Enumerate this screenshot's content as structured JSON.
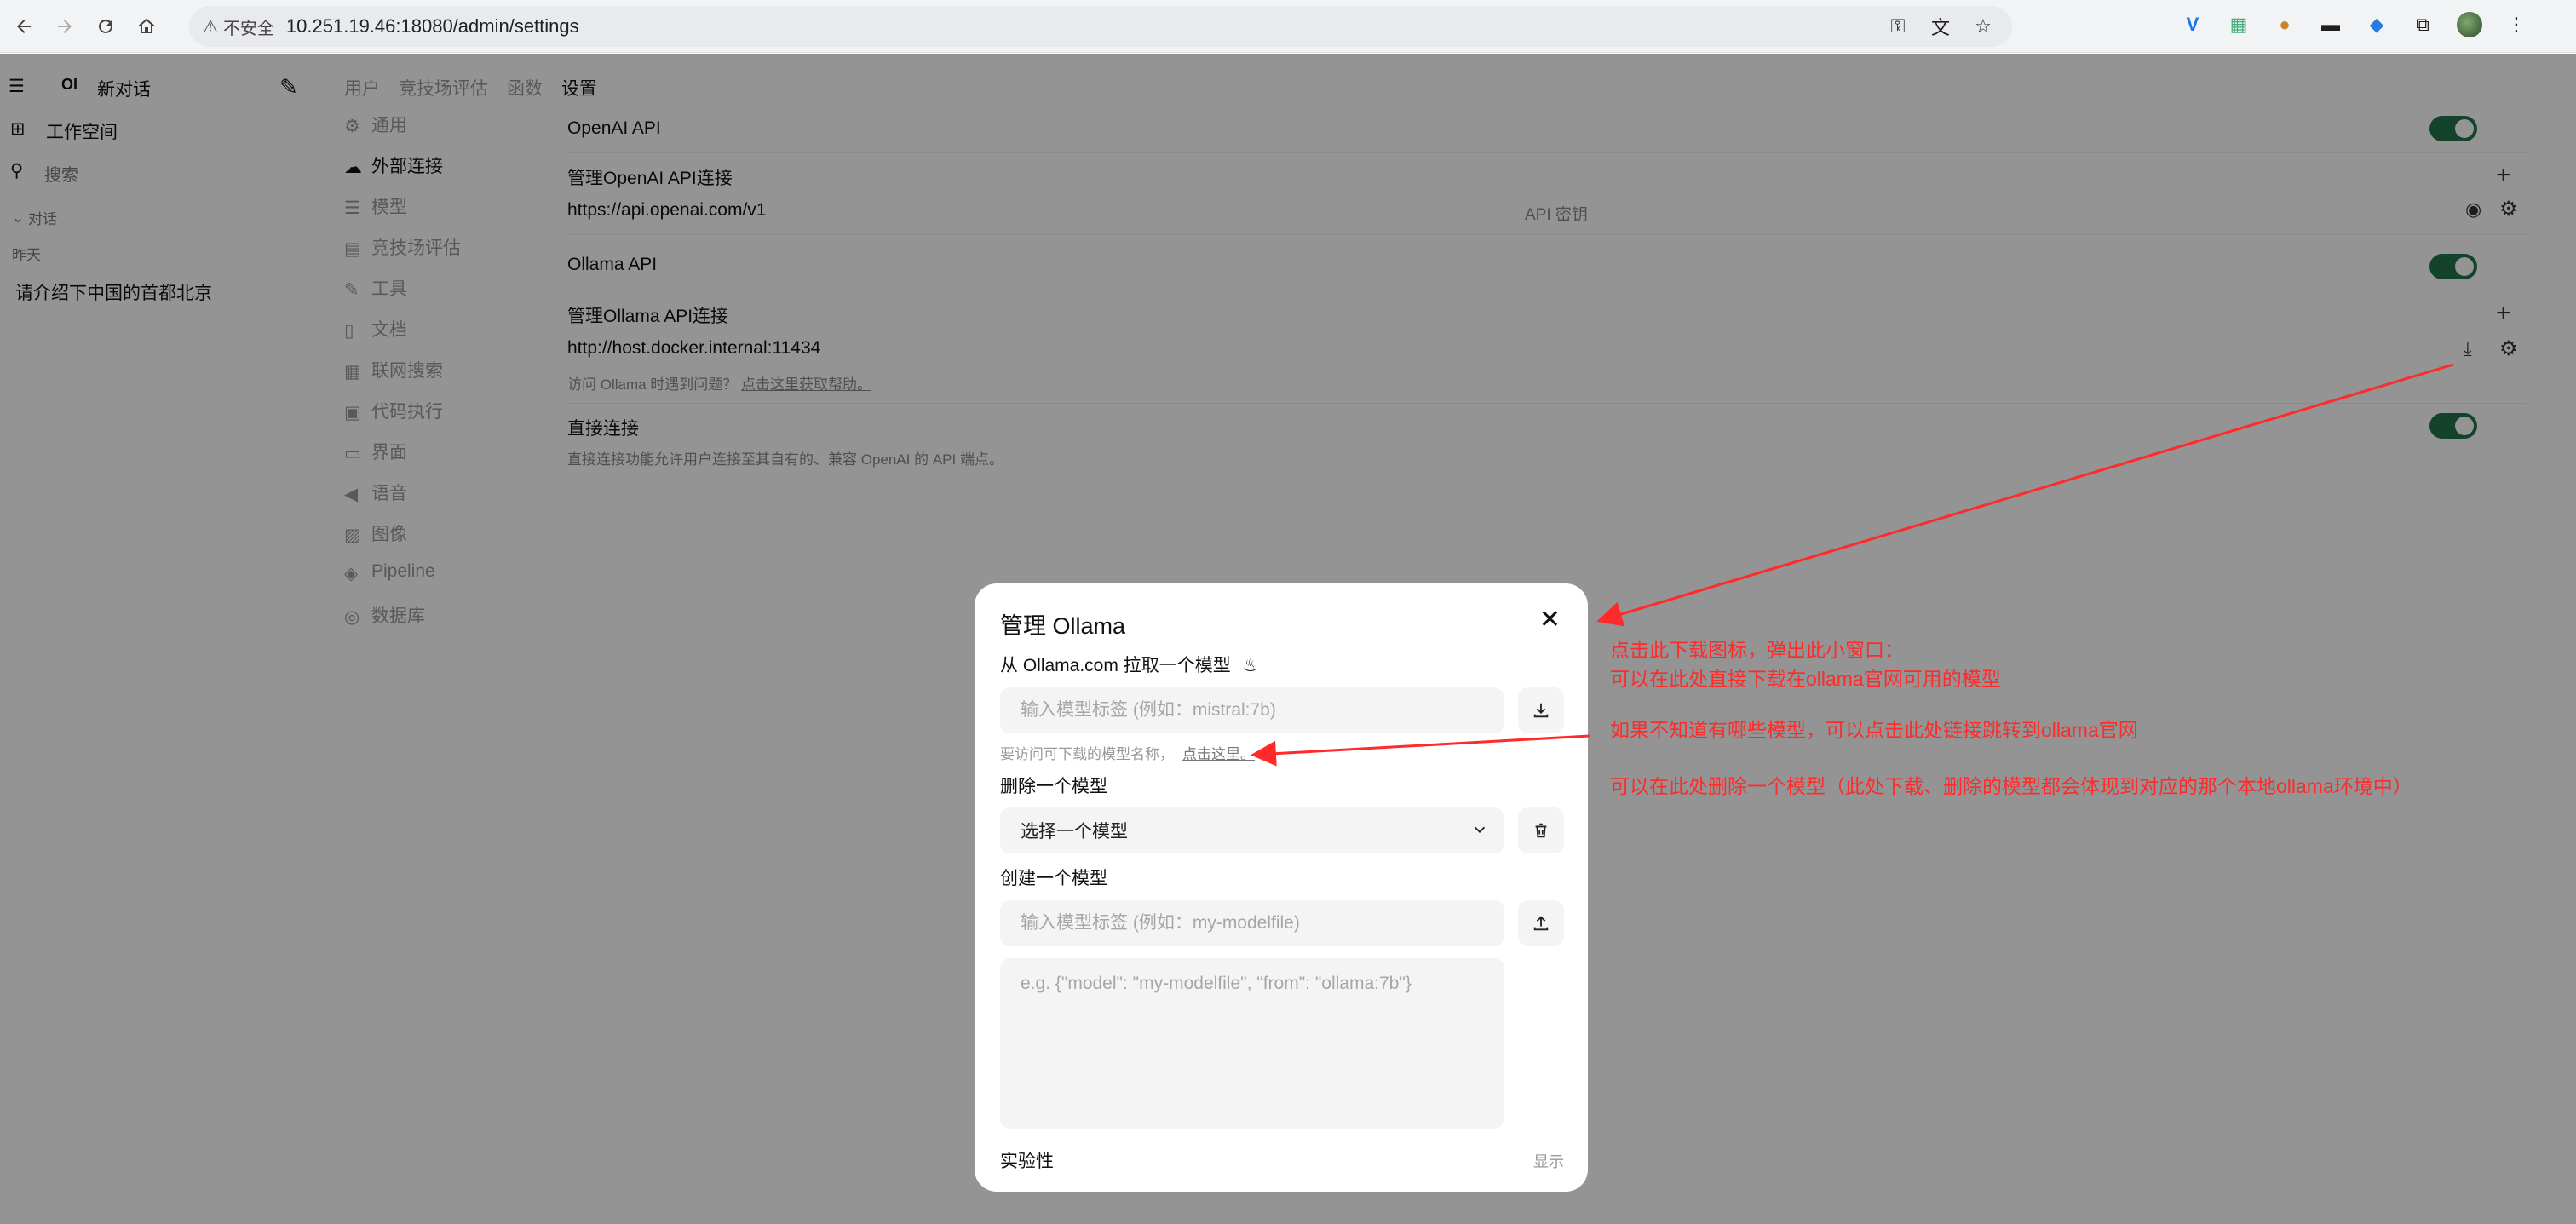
{
  "browser": {
    "insecure_label": "不安全",
    "url": "10.251.19.46:18080/admin/settings"
  },
  "sidebar": {
    "logo_text": "OI",
    "new_chat": "新对话",
    "workspace": "工作空间",
    "search_placeholder": "搜索",
    "chats_section": "对话",
    "yesterday": "昨天",
    "chat_items": [
      "请介绍下中国的首都北京"
    ]
  },
  "admin_menu": {
    "tabs": [
      "用户",
      "竞技场评估",
      "函数",
      "设置"
    ],
    "active_tab": "设置"
  },
  "settings_nav": {
    "items": [
      "通用",
      "外部连接",
      "模型",
      "竞技场评估",
      "工具",
      "文档",
      "联网搜索",
      "代码执行",
      "界面",
      "语音",
      "图像",
      "Pipeline",
      "数据库"
    ],
    "active": "外部连接"
  },
  "settings": {
    "openai_title": "OpenAI API",
    "openai_manage": "管理OpenAI API连接",
    "openai_url": "https://api.openai.com/v1",
    "openai_key_placeholder": "API 密钥",
    "ollama_title": "Ollama API",
    "ollama_manage": "管理Ollama API连接",
    "ollama_url": "http://host.docker.internal:11434",
    "ollama_hint": "访问 Ollama 时遇到问题？",
    "ollama_hint_link": "点击这里获取帮助。",
    "direct_title": "直接连接",
    "direct_desc": "直接连接功能允许用户连接至其自有的、兼容 OpenAI 的 API 端点。"
  },
  "modal": {
    "title": "管理 Ollama",
    "pull_label": "从 Ollama.com 拉取一个模型",
    "pull_placeholder": "输入模型标签 (例如：mistral:7b)",
    "pull_hint": "要访问可下载的模型名称，",
    "pull_hint_link": "点击这里。",
    "delete_label": "删除一个模型",
    "delete_select": "选择一个模型",
    "create_label": "创建一个模型",
    "create_placeholder": "输入模型标签 (例如：my-modelfile)",
    "create_json_placeholder": "e.g. {\"model\": \"my-modelfile\", \"from\": \"ollama:7b\"}",
    "experimental": "实验性",
    "show": "显示"
  },
  "annotations": {
    "note1_line1": "点击此下载图标，弹出此小窗口：",
    "note1_line2": "可以在此处直接下载在ollama官网可用的模型",
    "note2": "如果不知道有哪些模型，可以点击此处链接跳转到ollama官网",
    "note3": "可以在此处删除一个模型（此处下载、删除的模型都会体现到对应的那个本地ollama环境中）"
  },
  "colors": {
    "toggle_on": "#22764a",
    "annotation_red": "#ff2a2a",
    "overlay": "rgba(0,0,0,0.42)"
  }
}
